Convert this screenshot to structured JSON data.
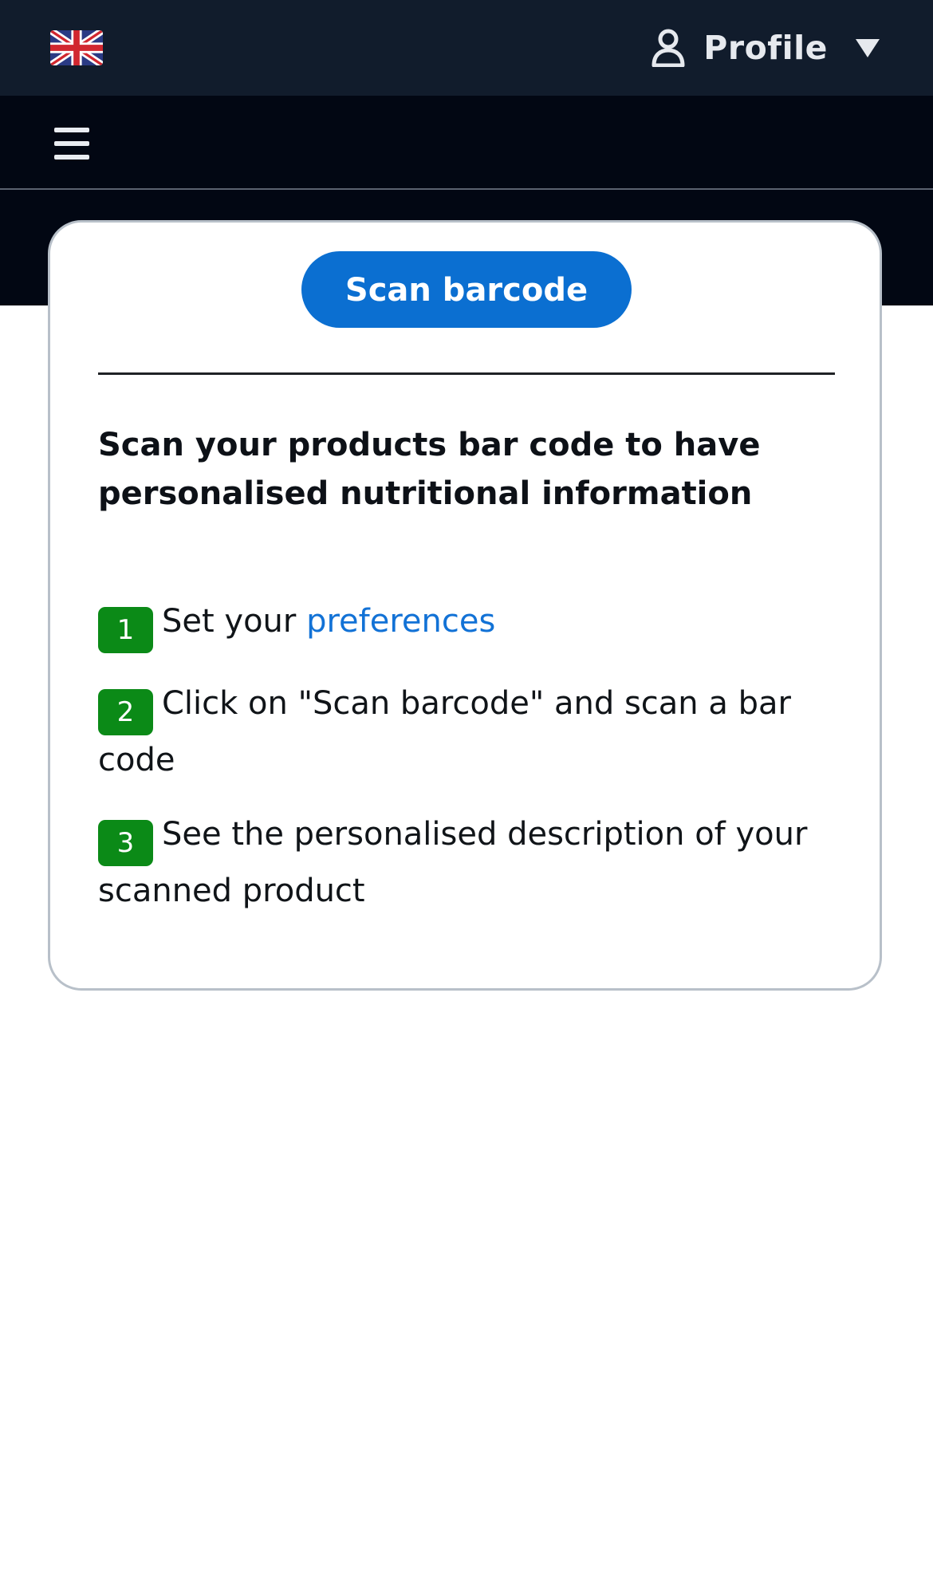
{
  "header": {
    "language_flag": "uk-flag-icon",
    "profile_label": "Profile"
  },
  "navbar": {
    "menu_icon": "hamburger-menu-icon"
  },
  "card": {
    "scan_button_label": "Scan barcode",
    "headline": "Scan your products bar code to have personalised nutritional information",
    "steps": [
      {
        "number": "1",
        "text_before": "Set your ",
        "link_text": "preferences"
      },
      {
        "number": "2",
        "text": "Click on \"Scan barcode\" and scan a bar code"
      },
      {
        "number": "3",
        "text": "See the personalised description of your scanned product"
      }
    ]
  },
  "colors": {
    "topbar": "#111c2c",
    "navbar": "#020713",
    "primary_button": "#0b6fd1",
    "step_badge": "#0b8a17",
    "link": "#1272d6"
  }
}
